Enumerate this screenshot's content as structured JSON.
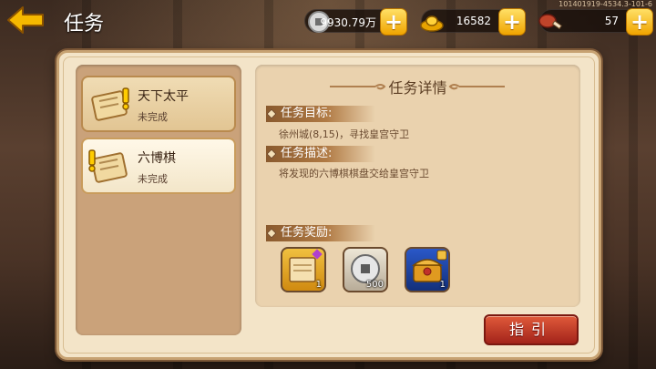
{
  "header": {
    "title": "任务",
    "build_id": "101401919-4534.3-101-6"
  },
  "resources": [
    {
      "name": "silver-coin",
      "value": "9930.79万"
    },
    {
      "name": "gold-ingot",
      "value": "16582"
    },
    {
      "name": "stamina",
      "value": "57"
    }
  ],
  "tasks": [
    {
      "name": "天下太平",
      "status": "未完成"
    },
    {
      "name": "六博棋",
      "status": "未完成"
    }
  ],
  "detail": {
    "title": "任务详情",
    "goal_label": "任务目标:",
    "goal_text": "徐州城(8,15)，寻找皇宫守卫",
    "desc_label": "任务描述:",
    "desc_text": "将发现的六博棋棋盘交给皇宫守卫",
    "reward_label": "任务奖励:",
    "rewards": [
      {
        "icon": "quest-scroll-icon",
        "count": "1"
      },
      {
        "icon": "silver-coin-icon",
        "count": "500"
      },
      {
        "icon": "treasure-chest-icon",
        "count": "1"
      }
    ]
  },
  "guide_button": "指引",
  "colors": {
    "panel_bg": "#f3e4c8",
    "list_bg": "#caa27a",
    "button_red": "#c23a26",
    "plus_yellow": "#f5b800"
  }
}
